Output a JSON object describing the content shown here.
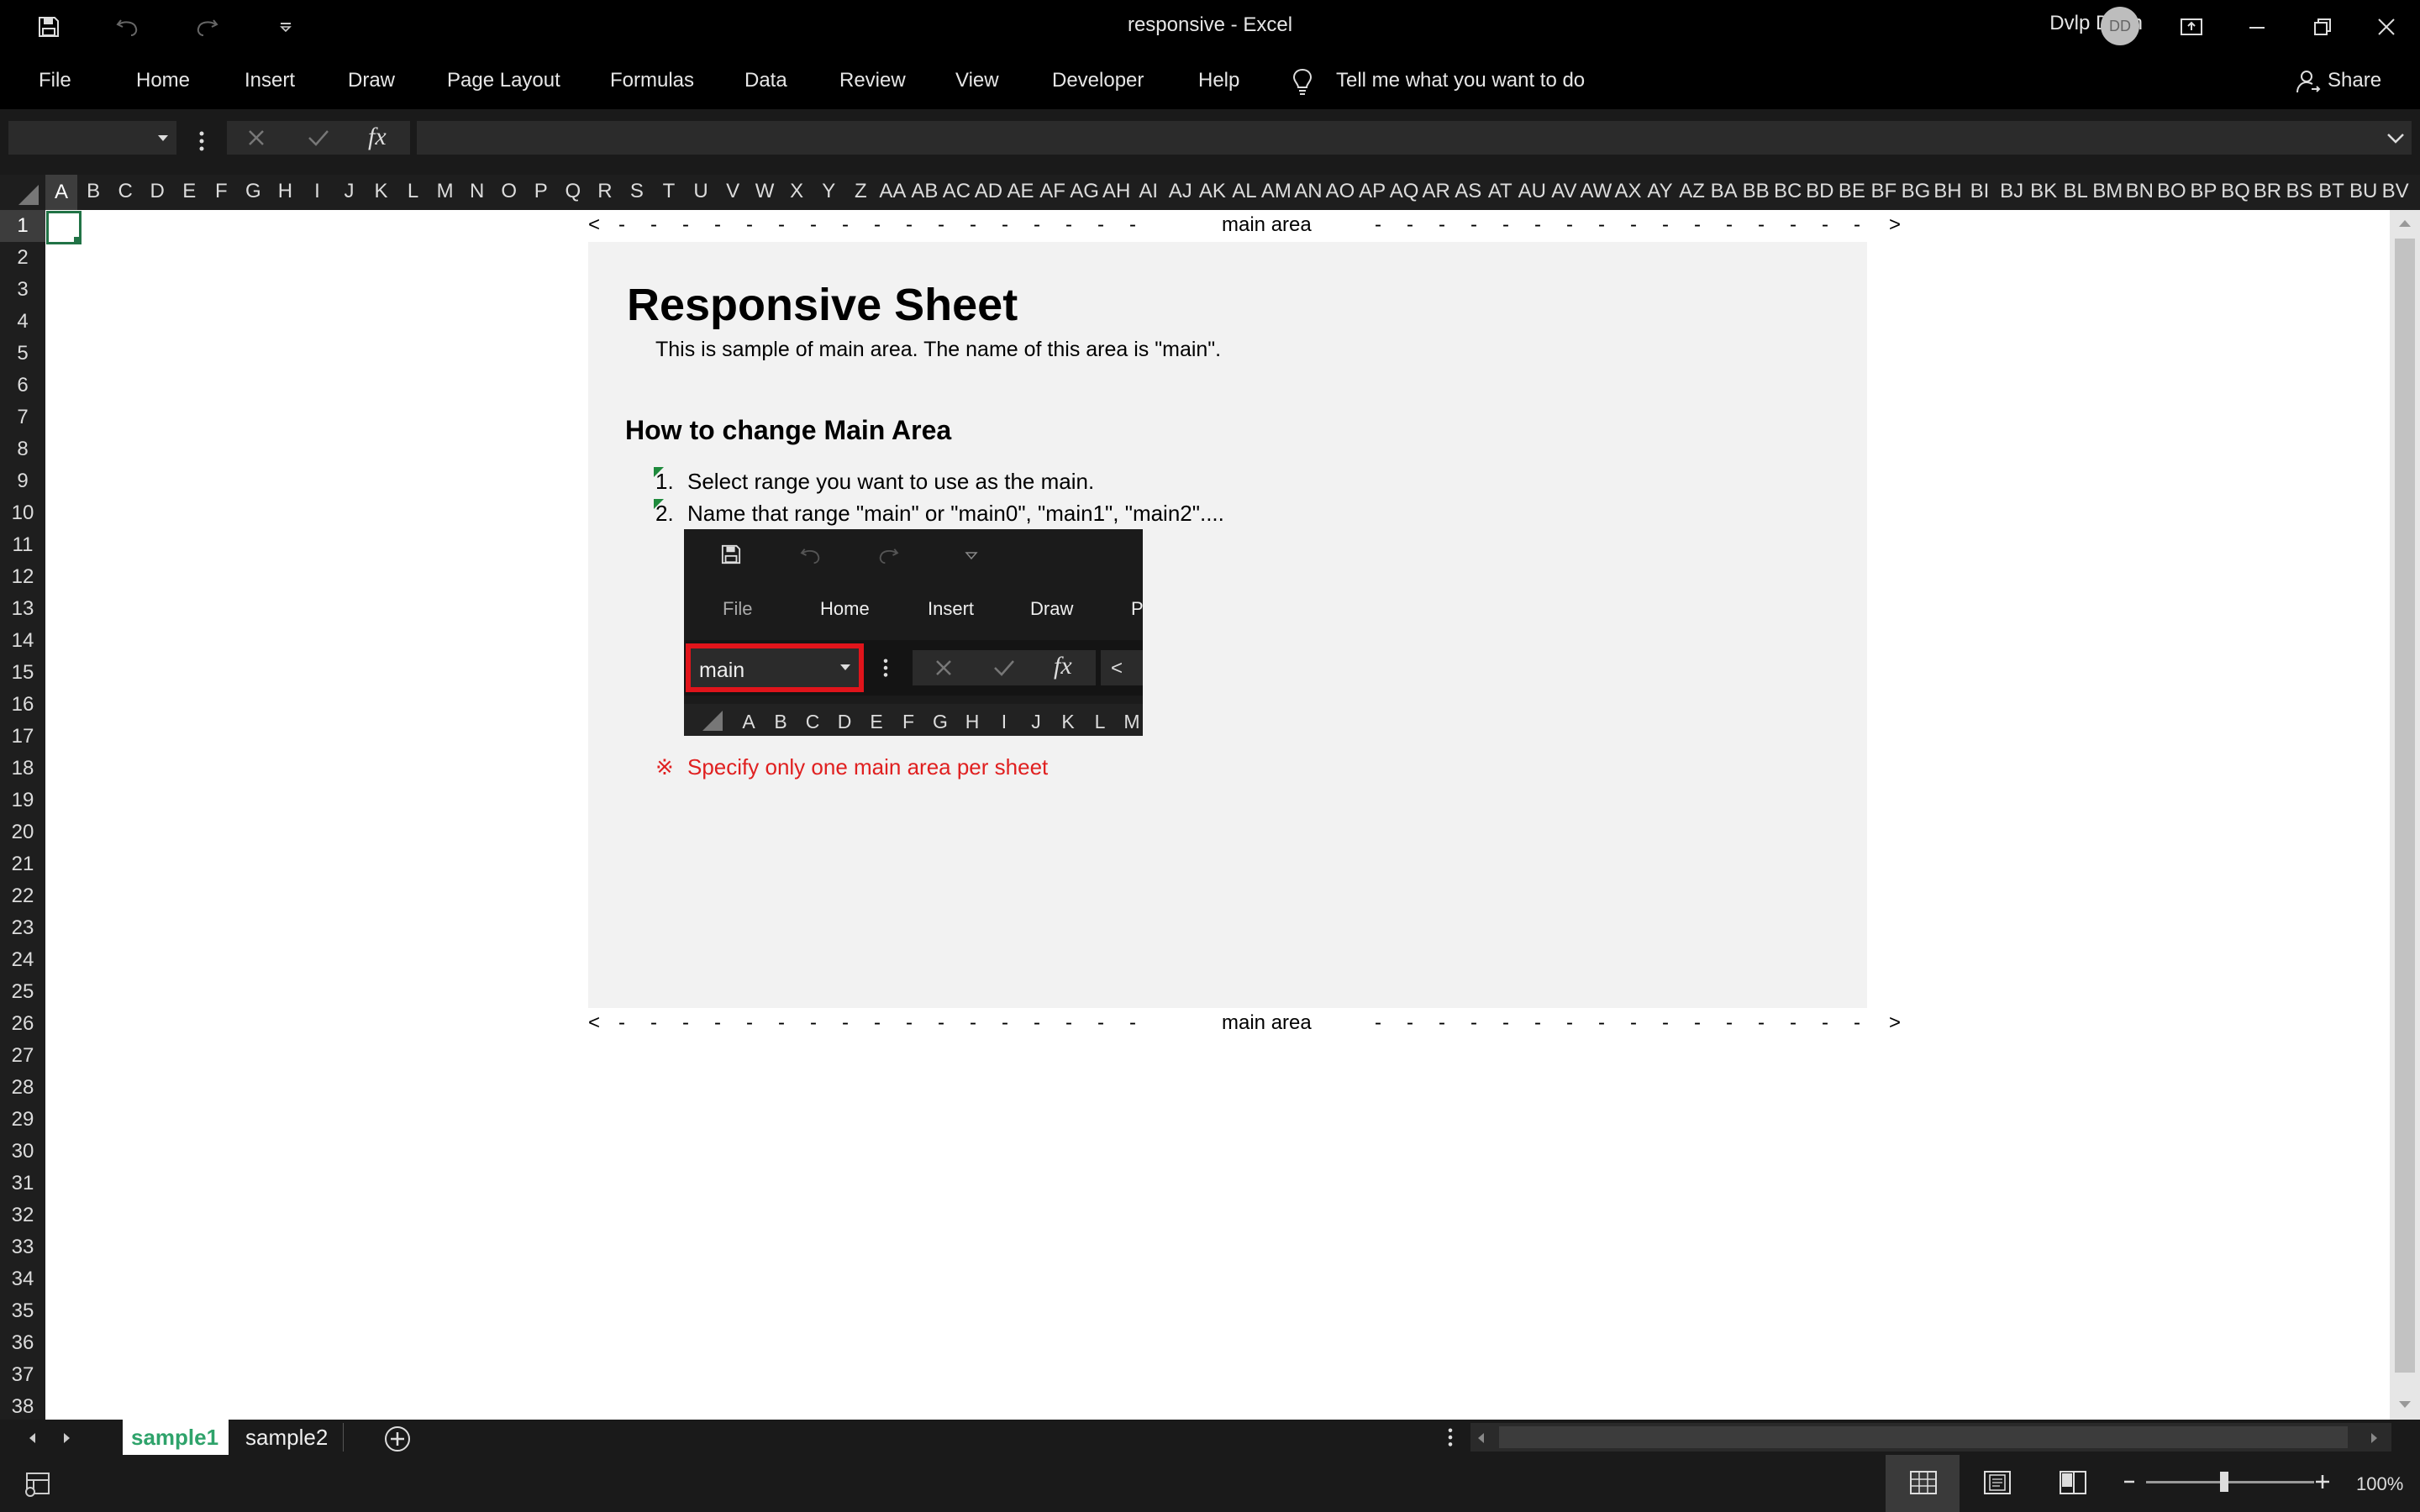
{
  "window": {
    "title": "responsive  -  Excel",
    "user_name": "Dvlp Dsgn",
    "avatar_initials": "DD"
  },
  "ribbon": {
    "tabs": [
      "File",
      "Home",
      "Insert",
      "Draw",
      "Page Layout",
      "Formulas",
      "Data",
      "Review",
      "View",
      "Developer",
      "Help"
    ],
    "tell_me": "Tell me what you want to do",
    "share": "Share"
  },
  "formula_bar": {
    "name_box_value": "",
    "fx_label": "fx",
    "formula": ""
  },
  "columns": [
    "A",
    "B",
    "C",
    "D",
    "E",
    "F",
    "G",
    "H",
    "I",
    "J",
    "K",
    "L",
    "M",
    "N",
    "O",
    "P",
    "Q",
    "R",
    "S",
    "T",
    "U",
    "V",
    "W",
    "X",
    "Y",
    "Z",
    "AA",
    "AB",
    "AC",
    "AD",
    "AE",
    "AF",
    "AG",
    "AH",
    "AI",
    "AJ",
    "AK",
    "AL",
    "AM",
    "AN",
    "AO",
    "AP",
    "AQ",
    "AR",
    "AS",
    "AT",
    "AU",
    "AV",
    "AW",
    "AX",
    "AY",
    "AZ",
    "BA",
    "BB",
    "BC",
    "BD",
    "BE",
    "BF",
    "BG",
    "BH",
    "BI",
    "BJ",
    "BK",
    "BL",
    "BM",
    "BN",
    "BO",
    "BP",
    "BQ",
    "BR",
    "BS",
    "BT",
    "BU",
    "BV"
  ],
  "rows": [
    "1",
    "2",
    "3",
    "4",
    "5",
    "6",
    "7",
    "8",
    "9",
    "10",
    "11",
    "12",
    "13",
    "14",
    "15",
    "16",
    "17",
    "18",
    "19",
    "20",
    "21",
    "22",
    "23",
    "24",
    "25",
    "26",
    "27",
    "28",
    "29",
    "30",
    "31",
    "32",
    "33",
    "34",
    "35",
    "36",
    "37",
    "38"
  ],
  "sheet": {
    "marker_left": "<",
    "marker_right": ">",
    "marker_dashes": "-",
    "marker_label": "main area",
    "heading": "Responsive Sheet",
    "subtext": "This is sample of main area. The name of this area is \"main\".",
    "section_heading": "How to change Main Area",
    "steps": [
      {
        "num": "1.",
        "text": "Select range you want to use as the main."
      },
      {
        "num": "2.",
        "text": "Name that range \"main\" or \"main0\", \"main1\", \"main2\"...."
      }
    ],
    "note_mark": "※",
    "note": "Specify only one main area per sheet",
    "note_color": "#e02020",
    "area_bg": "#f2f2f2"
  },
  "embedded_screenshot": {
    "tabs": [
      "File",
      "Home",
      "Insert",
      "Draw",
      "Pa"
    ],
    "name_box_value": "main",
    "fx_label": "fx",
    "overflow": "<",
    "columns": [
      "A",
      "B",
      "C",
      "D",
      "E",
      "F",
      "G",
      "H",
      "I",
      "J",
      "K",
      "L",
      "M"
    ],
    "highlight_color": "#e0141b"
  },
  "sheet_tabs": {
    "tabs": [
      "sample1",
      "sample2"
    ],
    "active": "sample1",
    "active_color": "#2fa36b"
  },
  "status": {
    "zoom": "100%"
  }
}
